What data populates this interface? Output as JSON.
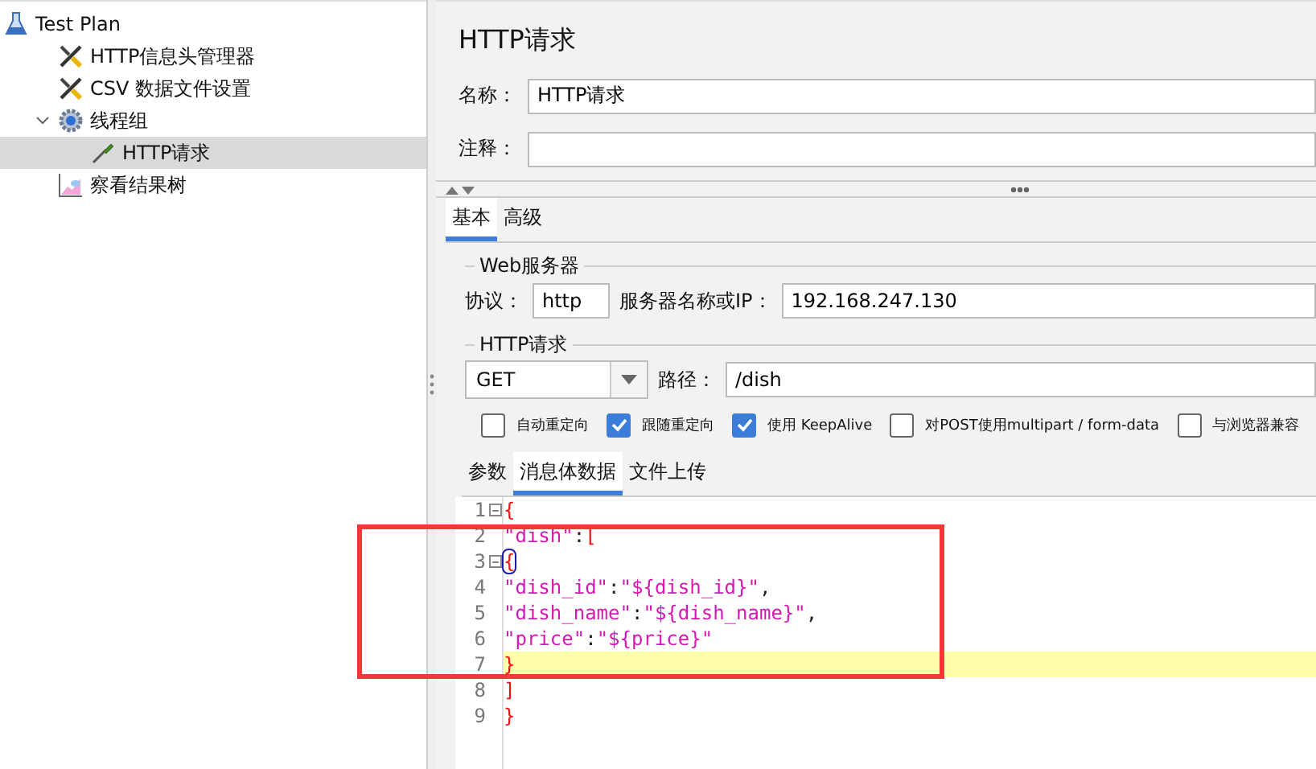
{
  "tree": [
    {
      "label": "Test Plan",
      "kind": "plan",
      "selected": false,
      "children": [
        {
          "label": "HTTP信息头管理器",
          "kind": "tools",
          "selected": false
        },
        {
          "label": "CSV 数据文件设置",
          "kind": "tools",
          "selected": false
        },
        {
          "label": "线程组",
          "kind": "gear",
          "selected": false,
          "expanded": true,
          "children": [
            {
              "label": "HTTP请求",
              "kind": "sampler",
              "selected": true
            }
          ]
        },
        {
          "label": "察看结果树",
          "kind": "graph",
          "selected": false
        }
      ]
    }
  ],
  "panel": {
    "title": "HTTP请求",
    "fields": [
      {
        "label": "名称：",
        "value": "HTTP请求"
      },
      {
        "label": "注释："
      }
    ],
    "tabs": [
      {
        "label": "基本",
        "selected": true
      },
      {
        "label": "高级",
        "selected": false
      }
    ],
    "web_server": {
      "legend": "Web服务器",
      "protocol_label": "协议：",
      "protocol": "http",
      "server_label": "服务器名称或IP：",
      "server": "192.168.247.130"
    },
    "http_request": {
      "legend": "HTTP请求",
      "method": "GET",
      "path_label": "路径：",
      "path": "/dish"
    },
    "options": [
      {
        "label": "自动重定向",
        "checked": false
      },
      {
        "label": "跟随重定向",
        "checked": true
      },
      {
        "label": "使用 KeepAlive",
        "checked": true
      },
      {
        "label": "对POST使用multipart / form-data",
        "checked": false
      },
      {
        "label": "与浏览器兼容",
        "checked": false
      }
    ],
    "body_tabs": [
      {
        "label": "参数",
        "selected": false
      },
      {
        "label": "消息体数据",
        "selected": true
      },
      {
        "label": "文件上传",
        "selected": false
      }
    ],
    "editor": {
      "lines": [
        {
          "number": "1",
          "fold": true,
          "current": false,
          "tokens": [
            {
              "kind": "brace",
              "text": "{",
              "matched": false
            }
          ]
        },
        {
          "number": "2",
          "fold": false,
          "current": false,
          "tokens": [
            {
              "kind": "string",
              "text": "\"dish\"",
              "matched": false
            },
            {
              "kind": "punct",
              "text": ":",
              "matched": false
            },
            {
              "kind": "brace",
              "text": "[",
              "matched": false
            }
          ]
        },
        {
          "number": "3",
          "fold": true,
          "current": false,
          "tokens": [
            {
              "kind": "brace",
              "text": "{",
              "matched": true
            }
          ]
        },
        {
          "number": "4",
          "fold": false,
          "current": false,
          "tokens": [
            {
              "kind": "string",
              "text": "\"dish_id\"",
              "matched": false
            },
            {
              "kind": "punct",
              "text": ":",
              "matched": false
            },
            {
              "kind": "string",
              "text": "\"${dish_id}\"",
              "matched": false
            },
            {
              "kind": "punct",
              "text": ",",
              "matched": false
            }
          ]
        },
        {
          "number": "5",
          "fold": false,
          "current": false,
          "tokens": [
            {
              "kind": "string",
              "text": "\"dish_name\"",
              "matched": false
            },
            {
              "kind": "punct",
              "text": ":",
              "matched": false
            },
            {
              "kind": "string",
              "text": "\"${dish_name}\"",
              "matched": false
            },
            {
              "kind": "punct",
              "text": ",",
              "matched": false
            }
          ]
        },
        {
          "number": "6",
          "fold": false,
          "current": false,
          "tokens": [
            {
              "kind": "string",
              "text": "\"price\"",
              "matched": false
            },
            {
              "kind": "punct",
              "text": ":",
              "matched": false
            },
            {
              "kind": "string",
              "text": "\"${price}\"",
              "matched": false
            }
          ]
        },
        {
          "number": "7",
          "fold": false,
          "current": true,
          "tokens": [
            {
              "kind": "brace",
              "text": "}",
              "matched": false
            }
          ]
        },
        {
          "number": "8",
          "fold": false,
          "current": false,
          "tokens": [
            {
              "kind": "brace",
              "text": "]",
              "matched": false
            }
          ]
        },
        {
          "number": "9",
          "fold": false,
          "current": false,
          "tokens": [
            {
              "kind": "brace",
              "text": "}",
              "matched": false
            }
          ]
        }
      ]
    }
  }
}
